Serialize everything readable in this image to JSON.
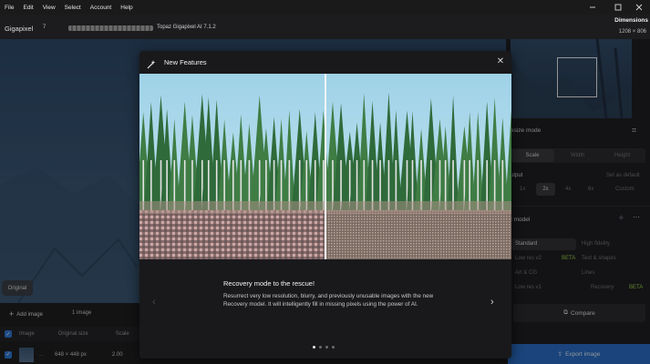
{
  "menubar": {
    "items": [
      "File",
      "Edit",
      "View",
      "Select",
      "Account",
      "Help"
    ]
  },
  "app": {
    "title": "Gigapixel",
    "badge": "7",
    "version": "Topaz Gigapixel AI 7.1.2"
  },
  "dimensions": {
    "label": "Dimensions",
    "value": "1208 × 806"
  },
  "canvas": {
    "original_button": "Original"
  },
  "bottom": {
    "add_image": "Add image",
    "image_count": "1 image",
    "columns": [
      "Image",
      "Original size",
      "Scale"
    ],
    "row": {
      "size": "648 × 448 px",
      "scale": "2.00"
    }
  },
  "right_panel": {
    "resize_mode_label": "esize mode",
    "tabs": [
      "Scale",
      "Width",
      "Height"
    ],
    "output_label": "utput",
    "output_hint": "Set as default",
    "scale_options": [
      "1x",
      "2x",
      "4x",
      "6x",
      "Custom"
    ],
    "ai_model_label": "I model",
    "models_left": [
      "Standard",
      "Low res v2",
      "Art & CG",
      "Low res v1"
    ],
    "models_right": [
      "High fidelity",
      "Text & shapes",
      "Lines",
      "Recovery"
    ],
    "beta_tag": "BETA",
    "compare_button": "Compare",
    "export_button": "Export image"
  },
  "modal": {
    "title": "New Features",
    "feature_title": "Recovery mode to the rescue!",
    "feature_desc": "Resurrect very low resolution, blurry, and previously unusable images with the new Recovery model. It will intelligently fill in missing pixels using the power of AI.",
    "page_count": 4,
    "active_page": 1
  },
  "colors": {
    "accent": "#2b6fc7",
    "beta": "#9bd44a",
    "bg": "#1c1c1e"
  }
}
